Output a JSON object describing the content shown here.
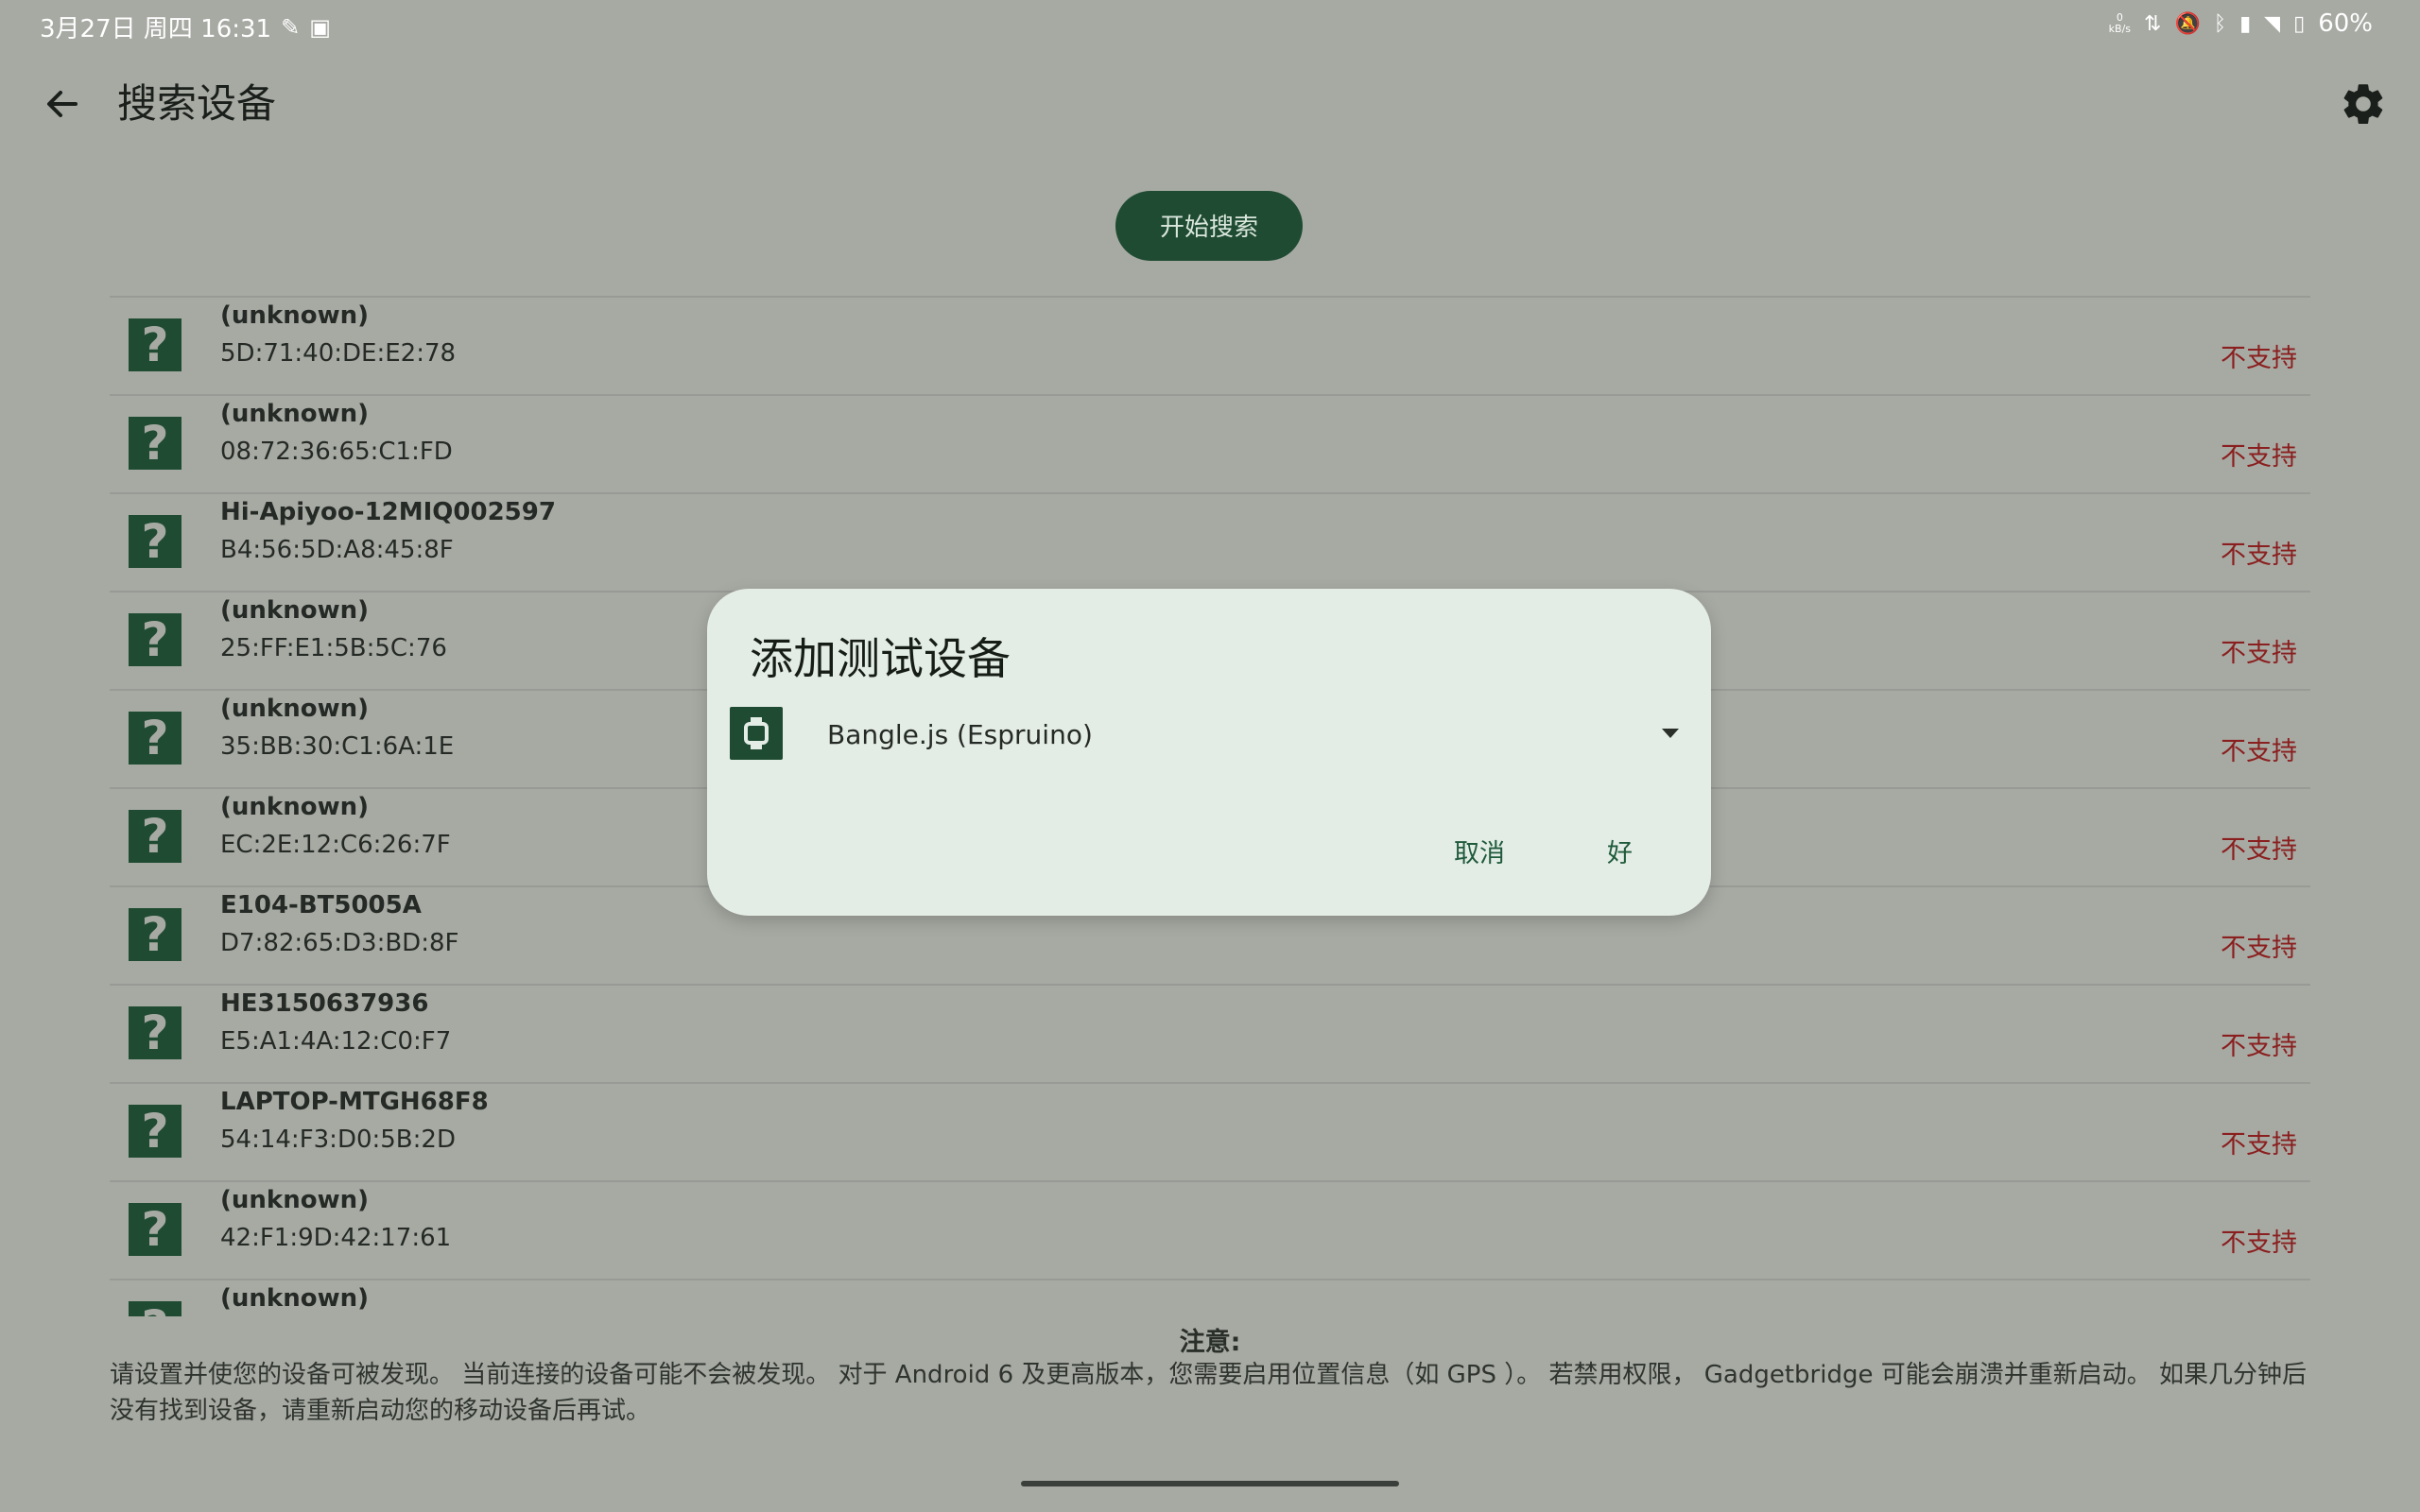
{
  "statusbar": {
    "datetime": "3月27日 周四 16:31",
    "net_speed_value": "0",
    "net_speed_unit": "kB/s",
    "battery": "60%"
  },
  "appbar": {
    "title": "搜索设备"
  },
  "search_button": "开始搜索",
  "devices": [
    {
      "name": "(unknown)",
      "address": "5D:71:40:DE:E2:78",
      "status": "不支持"
    },
    {
      "name": "(unknown)",
      "address": "08:72:36:65:C1:FD",
      "status": "不支持"
    },
    {
      "name": "Hi-Apiyoo-12MIQ002597",
      "address": "B4:56:5D:A8:45:8F",
      "status": "不支持"
    },
    {
      "name": "(unknown)",
      "address": "25:FF:E1:5B:5C:76",
      "status": "不支持"
    },
    {
      "name": "(unknown)",
      "address": "35:BB:30:C1:6A:1E",
      "status": "不支持"
    },
    {
      "name": "(unknown)",
      "address": "EC:2E:12:C6:26:7F",
      "status": "不支持"
    },
    {
      "name": "E104-BT5005A",
      "address": "D7:82:65:D3:BD:8F",
      "status": "不支持"
    },
    {
      "name": "HE3150637936",
      "address": "E5:A1:4A:12:C0:F7",
      "status": "不支持"
    },
    {
      "name": "LAPTOP-MTGH68F8",
      "address": "54:14:F3:D0:5B:2D",
      "status": "不支持"
    },
    {
      "name": "(unknown)",
      "address": "42:F1:9D:42:17:61",
      "status": "不支持"
    },
    {
      "name": "(unknown)",
      "address": "",
      "status": ""
    }
  ],
  "note": {
    "title": "注意:",
    "text": "请设置并使您的设备可被发现。 当前连接的设备可能不会被发现。 对于 Android 6 及更高版本，您需要启用位置信息（如 GPS ）。 若禁用权限， Gadgetbridge 可能会崩溃并重新启动。 如果几分钟后没有找到设备，请重新启动您的移动设备后再试。"
  },
  "dialog": {
    "title": "添加测试设备",
    "selected_device": "Bangle.js (Espruino)",
    "cancel_label": "取消",
    "ok_label": "好"
  },
  "colors": {
    "background": "#a7aaa3",
    "accent": "#1f4b32",
    "unsupported": "#8a1f1f",
    "dialog_bg": "#e4ede5"
  }
}
